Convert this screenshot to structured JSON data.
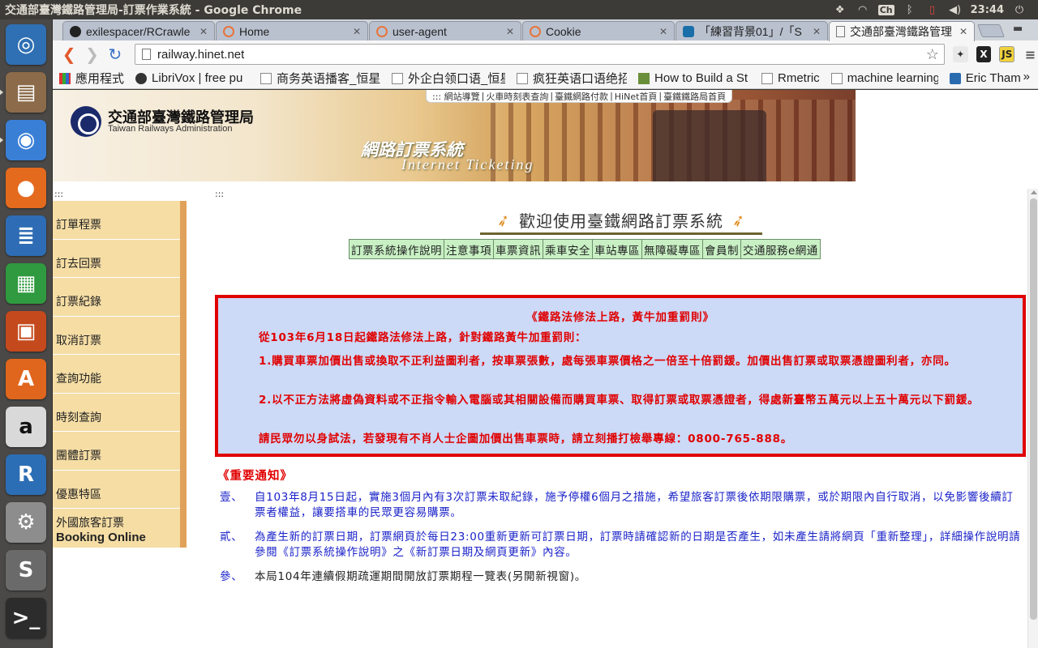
{
  "window": {
    "title": "交通部臺灣鐵路管理局-訂票作業系統 - Google Chrome",
    "clock": "23:44",
    "input_indicator": "Ch"
  },
  "launcher": {
    "items": [
      {
        "name": "ubuntu-dash-icon",
        "color": "#2f6fb3",
        "glyph": "◎"
      },
      {
        "name": "files-icon",
        "color": "#8b6b4a",
        "glyph": "▤"
      },
      {
        "name": "chrome-icon",
        "color": "#3a7fd6",
        "glyph": "◉"
      },
      {
        "name": "firefox-icon",
        "color": "#e46a1e",
        "glyph": "●"
      },
      {
        "name": "libreoffice-writer-icon",
        "color": "#2e6db5",
        "glyph": "≣"
      },
      {
        "name": "libreoffice-calc-icon",
        "color": "#2f9a3f",
        "glyph": "▦"
      },
      {
        "name": "libreoffice-impress-icon",
        "color": "#c44a1e",
        "glyph": "▣"
      },
      {
        "name": "software-center-icon",
        "color": "#e0661d",
        "glyph": "A"
      },
      {
        "name": "amazon-icon",
        "color": "#d9d9d9",
        "glyph": "a"
      },
      {
        "name": "r-icon",
        "color": "#2c6eb5",
        "glyph": "R"
      },
      {
        "name": "system-settings-icon",
        "color": "#8d8d8d",
        "glyph": "⚙"
      },
      {
        "name": "sublime-text-icon",
        "color": "#6a6a6a",
        "glyph": "S"
      },
      {
        "name": "terminal-icon",
        "color": "#2c2c2c",
        "glyph": ">_"
      }
    ]
  },
  "tabs": [
    {
      "label": "exilespacer/RCrawle",
      "fav": "#222222"
    },
    {
      "label": "Home",
      "fav": "#e8743a"
    },
    {
      "label": "user-agent",
      "fav": "#e8743a"
    },
    {
      "label": "Cookie",
      "fav": "#e8743a"
    },
    {
      "label": "「練習背景01」/「S",
      "fav": "#1b6fa8"
    },
    {
      "label": "交通部臺灣鐵路管理",
      "fav": "#ffffff"
    }
  ],
  "toolbar": {
    "url": "railway.hinet.net"
  },
  "bookmarks": [
    {
      "label": "應用程式"
    },
    {
      "label": "LibriVox | free pu"
    },
    {
      "label": "商务英语播客_恒星"
    },
    {
      "label": "外企白领口语_恒星"
    },
    {
      "label": "疯狂英语口语绝招"
    },
    {
      "label": "How to Build a St"
    },
    {
      "label": "Rmetric"
    },
    {
      "label": "machine learning"
    },
    {
      "label": "Eric Tham"
    }
  ],
  "banner": {
    "top_links": [
      "::: 網站導覽",
      "火車時刻表查詢",
      "臺鐵網路付款",
      "HiNet首頁",
      "臺鐵鐵路局首頁"
    ],
    "org_name": "交通部臺灣鐵路管理局",
    "org_en": "Taiwan Railways Administration",
    "system_name": "網路訂票系統",
    "system_en": "Internet Ticketing"
  },
  "page": {
    "dots": ":::",
    "welcome": "歡迎使用臺鐵網路訂票系統",
    "nav": [
      "訂票系統操作說明",
      "注意事項",
      "車票資訊",
      "乘車安全",
      "車站專區",
      "無障礙專區",
      "會員制",
      "交通服務e網通"
    ]
  },
  "menu": {
    "items": [
      "訂單程票",
      "訂去回票",
      "訂票紀錄",
      "取消訂票",
      "查詢功能",
      "時刻查詢",
      "團體訂票",
      "優惠特區"
    ],
    "foreign_zh": "外國旅客訂票",
    "foreign_en": "Booking Online"
  },
  "warning": {
    "title": "《鐵路法修法上路，黃牛加重罰則》",
    "p1": "從103年6月18日起鐵路法修法上路，針對鐵路黃牛加重罰則：",
    "p2": "1.購買車票加價出售或換取不正利益圖利者，按車票張數，處每張車票價格之一倍至十倍罰鍰。加價出售訂票或取票憑證圖利者，亦同。",
    "p3": "2.以不正方法將虛偽資料或不正指令輸入電腦或其相關設備而購買車票、取得訂票或取票憑證者，得處新臺幣五萬元以上五十萬元以下罰鍰。",
    "p4": "請民眾勿以身試法，若發現有不肖人士企圖加價出售車票時，請立刻播打檢舉專線：0800-765-888。"
  },
  "notices": {
    "title": "《重要通知》",
    "items": [
      {
        "num": "壹、",
        "text": "自103年8月15日起，實施3個月內有3次訂票未取紀錄，施予停權6個月之措施，希望旅客訂票後依期限購票，或於期限內自行取消，以免影響後續訂票者權益，讓要搭車的民眾更容易購票。"
      },
      {
        "num": "貳、",
        "text": "為產生新的訂票日期，訂票網頁於每日23:00重新更新可訂票日期，訂票時請確認新的日期是否產生，如未產生請將網頁「重新整理」，詳細操作說明請參閱《訂票系統操作說明》之《新訂票日期及網頁更新》內容。"
      },
      {
        "num": "參、",
        "text": "本局104年連續假期疏運期間開放訂票期程一覽表(另開新視窗)。"
      }
    ]
  }
}
